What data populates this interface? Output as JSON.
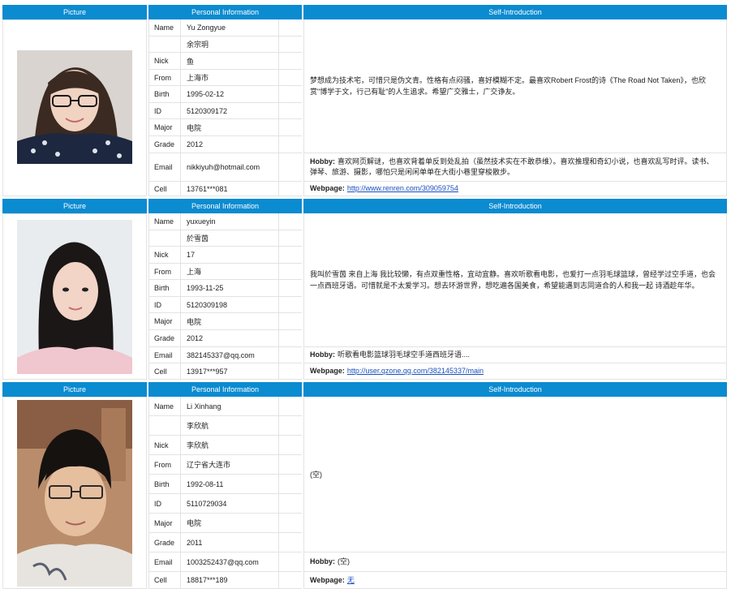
{
  "headers": {
    "picture": "Picture",
    "info": "Personal Information",
    "self": "Self-Introduction"
  },
  "labels": {
    "name": "Name",
    "nick": "Nick",
    "from": "From",
    "birth": "Birth",
    "id": "ID",
    "major": "Major",
    "grade": "Grade",
    "email": "Email",
    "cell": "Cell",
    "hobby": "Hobby:",
    "webpage": "Webpage:"
  },
  "people": [
    {
      "name_en": "Yu Zongyue",
      "name_cn": "余宗玥",
      "nick": "鱼",
      "from": "上海市",
      "birth": "1995-02-12",
      "id": "5120309172",
      "major": "电院",
      "grade": "2012",
      "email": "nikkiyuh@hotmail.com",
      "cell": "13761***081",
      "intro": "梦想成为技术宅，可惜只是伪文青。性格有点闷骚，喜好模糊不定。最喜欢Robert Frost的诗《The Road Not Taken》，也欣赏\"博学于文，行己有耻\"的人生追求。希望广交雅士，广交诤友。",
      "hobby": "喜欢网页解谜，也喜欢背着单反到处乱拍（虽然技术实在不敢恭维）。喜欢推理和奇幻小说，也喜欢乱写时评。读书、弹琴、旅游、摄影，哪怕只是闲闲单单在大街小巷里穿梭散步。",
      "webpage": "http://www.renren.com/309059754"
    },
    {
      "name_en": "yuxueyin",
      "name_cn": "於雪茵",
      "nick": "17",
      "from": "上海",
      "birth": "1993-11-25",
      "id": "5120309198",
      "major": "电院",
      "grade": "2012",
      "email": "382145337@qq.com",
      "cell": "13917***957",
      "intro": "我叫於雪茵 来自上海 我比较懒，有点双重性格，宜动宜静。喜欢听歌看电影，也爱打一点羽毛球篮球，曾经学过空手道，也会一点西班牙语。可惜就是不太爱学习。想去环游世界，想吃遍各国美食，希望能遇到志同道合的人和我一起 诗酒趁年华。",
      "hobby": "听歌看电影篮球羽毛球空手道西班牙语....",
      "webpage": "http://user.qzone.qq.com/382145337/main"
    },
    {
      "name_en": "Li Xinhang",
      "name_cn": "李欣航",
      "nick": "李欣航",
      "from": "辽宁省大连市",
      "birth": "1992-08-11",
      "id": "5110729034",
      "major": "电院",
      "grade": "2011",
      "email": "1003252437@qq.com",
      "cell": "18817***189",
      "intro": "(空)",
      "hobby": "(空)",
      "webpage": "无"
    }
  ],
  "colors": {
    "header_bg": "#0b8bd0",
    "header_text": "#ffffff",
    "link": "#1a4fbf",
    "border": "#e3e3e3"
  }
}
